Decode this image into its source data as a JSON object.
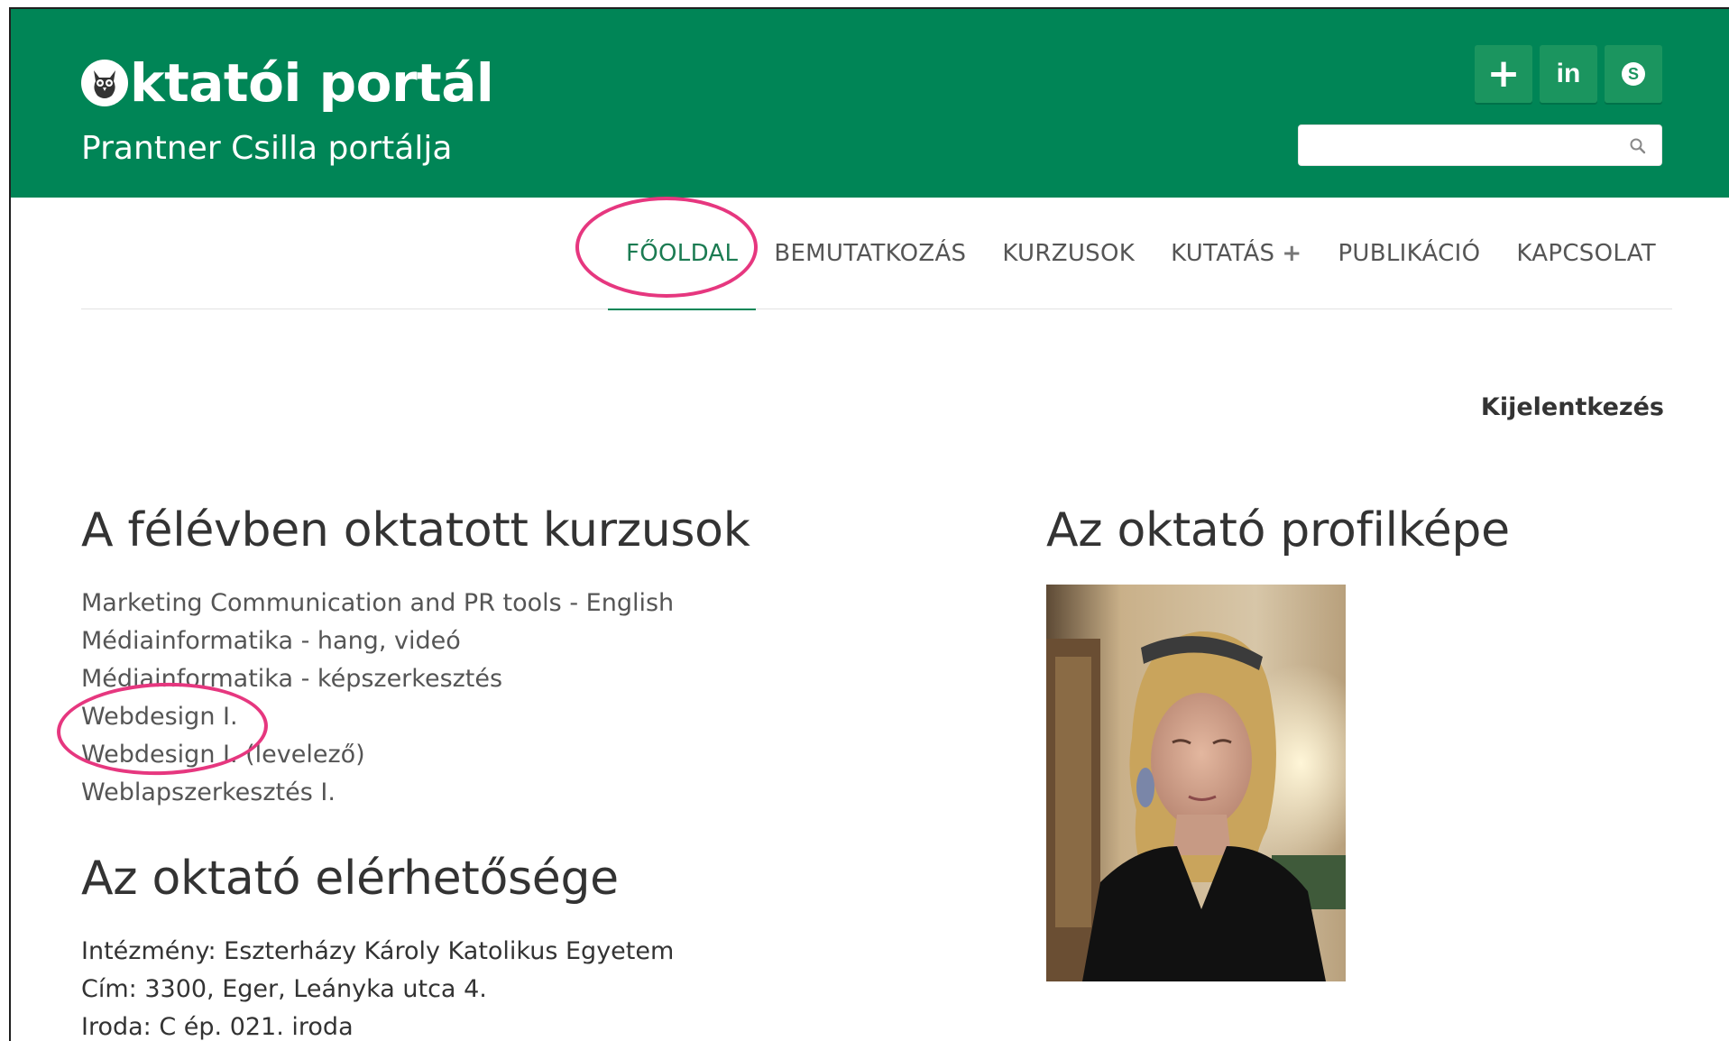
{
  "header": {
    "brand_text": "ktatói portál",
    "subtitle": "Prantner Csilla portálja",
    "social": [
      {
        "icon": "plus-icon",
        "label": "+"
      },
      {
        "icon": "linkedin-icon",
        "label": "in"
      },
      {
        "icon": "skype-icon",
        "label": "S"
      }
    ],
    "search": {
      "placeholder": "",
      "value": ""
    }
  },
  "nav": {
    "items": [
      {
        "label": "FŐOLDAL",
        "active": true
      },
      {
        "label": "BEMUTATKOZÁS"
      },
      {
        "label": "KURZUSOK"
      },
      {
        "label": "KUTATÁS",
        "suffix": "+"
      },
      {
        "label": "PUBLIKÁCIÓ"
      },
      {
        "label": "KAPCSOLAT"
      }
    ]
  },
  "logout_label": "Kijelentkezés",
  "courses": {
    "title": "A félévben oktatott kurzusok",
    "items": [
      "Marketing Communication and PR tools - English",
      "Médiainformatika - hang, videó",
      "Médiainformatika - képszerkesztés",
      "Webdesign I.",
      "Webdesign I. (levelező)",
      "Weblapszerkesztés I."
    ]
  },
  "contact": {
    "title": "Az oktató elérhetősége",
    "lines": [
      "Intézmény: Eszterházy Károly Katolikus Egyetem",
      "Cím: 3300, Eger, Leányka utca 4.",
      "Iroda: C ép. 021. iroda"
    ]
  },
  "profile": {
    "title": "Az oktató profilképe"
  },
  "colors": {
    "header_green": "#008556",
    "active_nav": "#1b7b52",
    "annotation": "#e6377f"
  }
}
